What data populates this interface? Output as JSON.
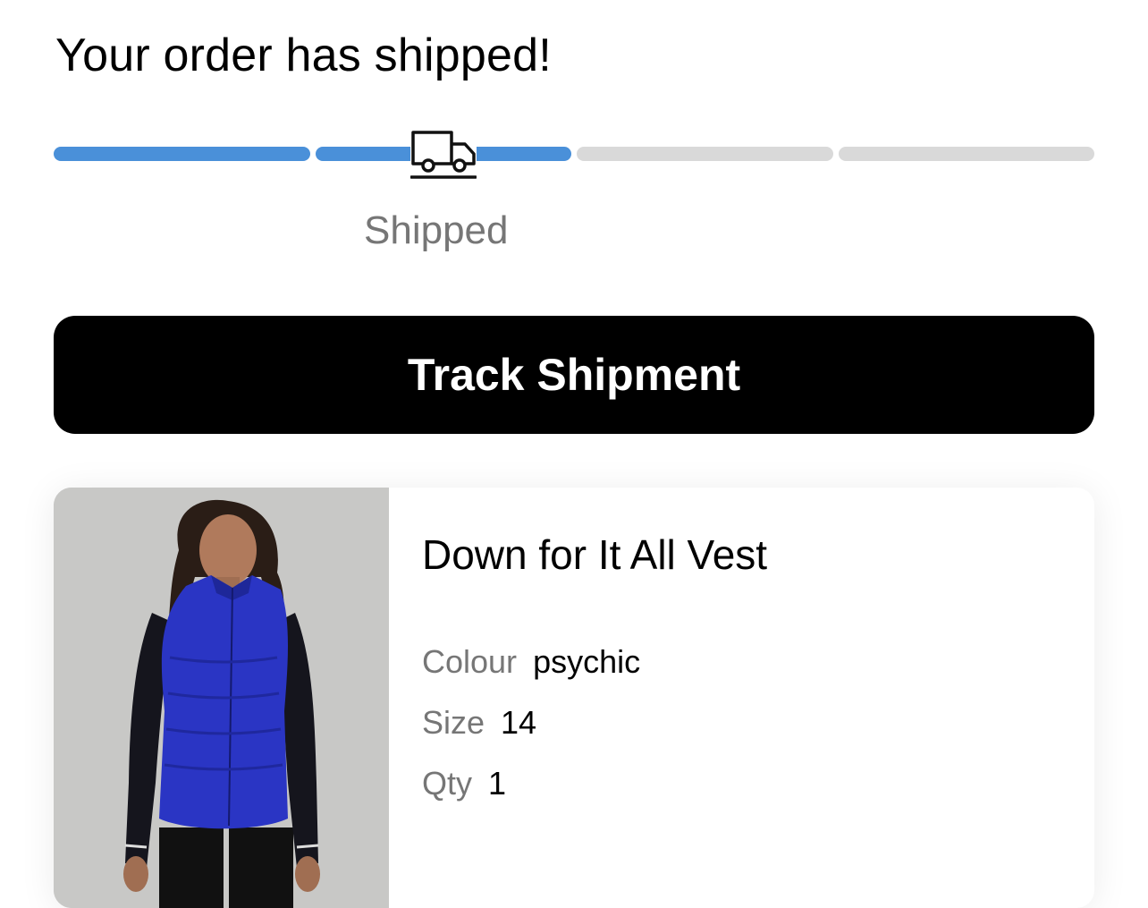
{
  "header": {
    "title": "Your order has shipped!"
  },
  "progress": {
    "steps_total": 4,
    "steps_complete": 2,
    "current_step_label": "Shipped",
    "current_step_icon": "truck-icon",
    "colors": {
      "complete": "#4a90d9",
      "incomplete": "#d9d9d9"
    }
  },
  "actions": {
    "track_label": "Track Shipment"
  },
  "product": {
    "name": "Down for It All Vest",
    "image_icon": "product-photo-vest",
    "attributes": [
      {
        "label": "Colour",
        "value": "psychic"
      },
      {
        "label": "Size",
        "value": "14"
      },
      {
        "label": "Qty",
        "value": "1"
      }
    ]
  }
}
